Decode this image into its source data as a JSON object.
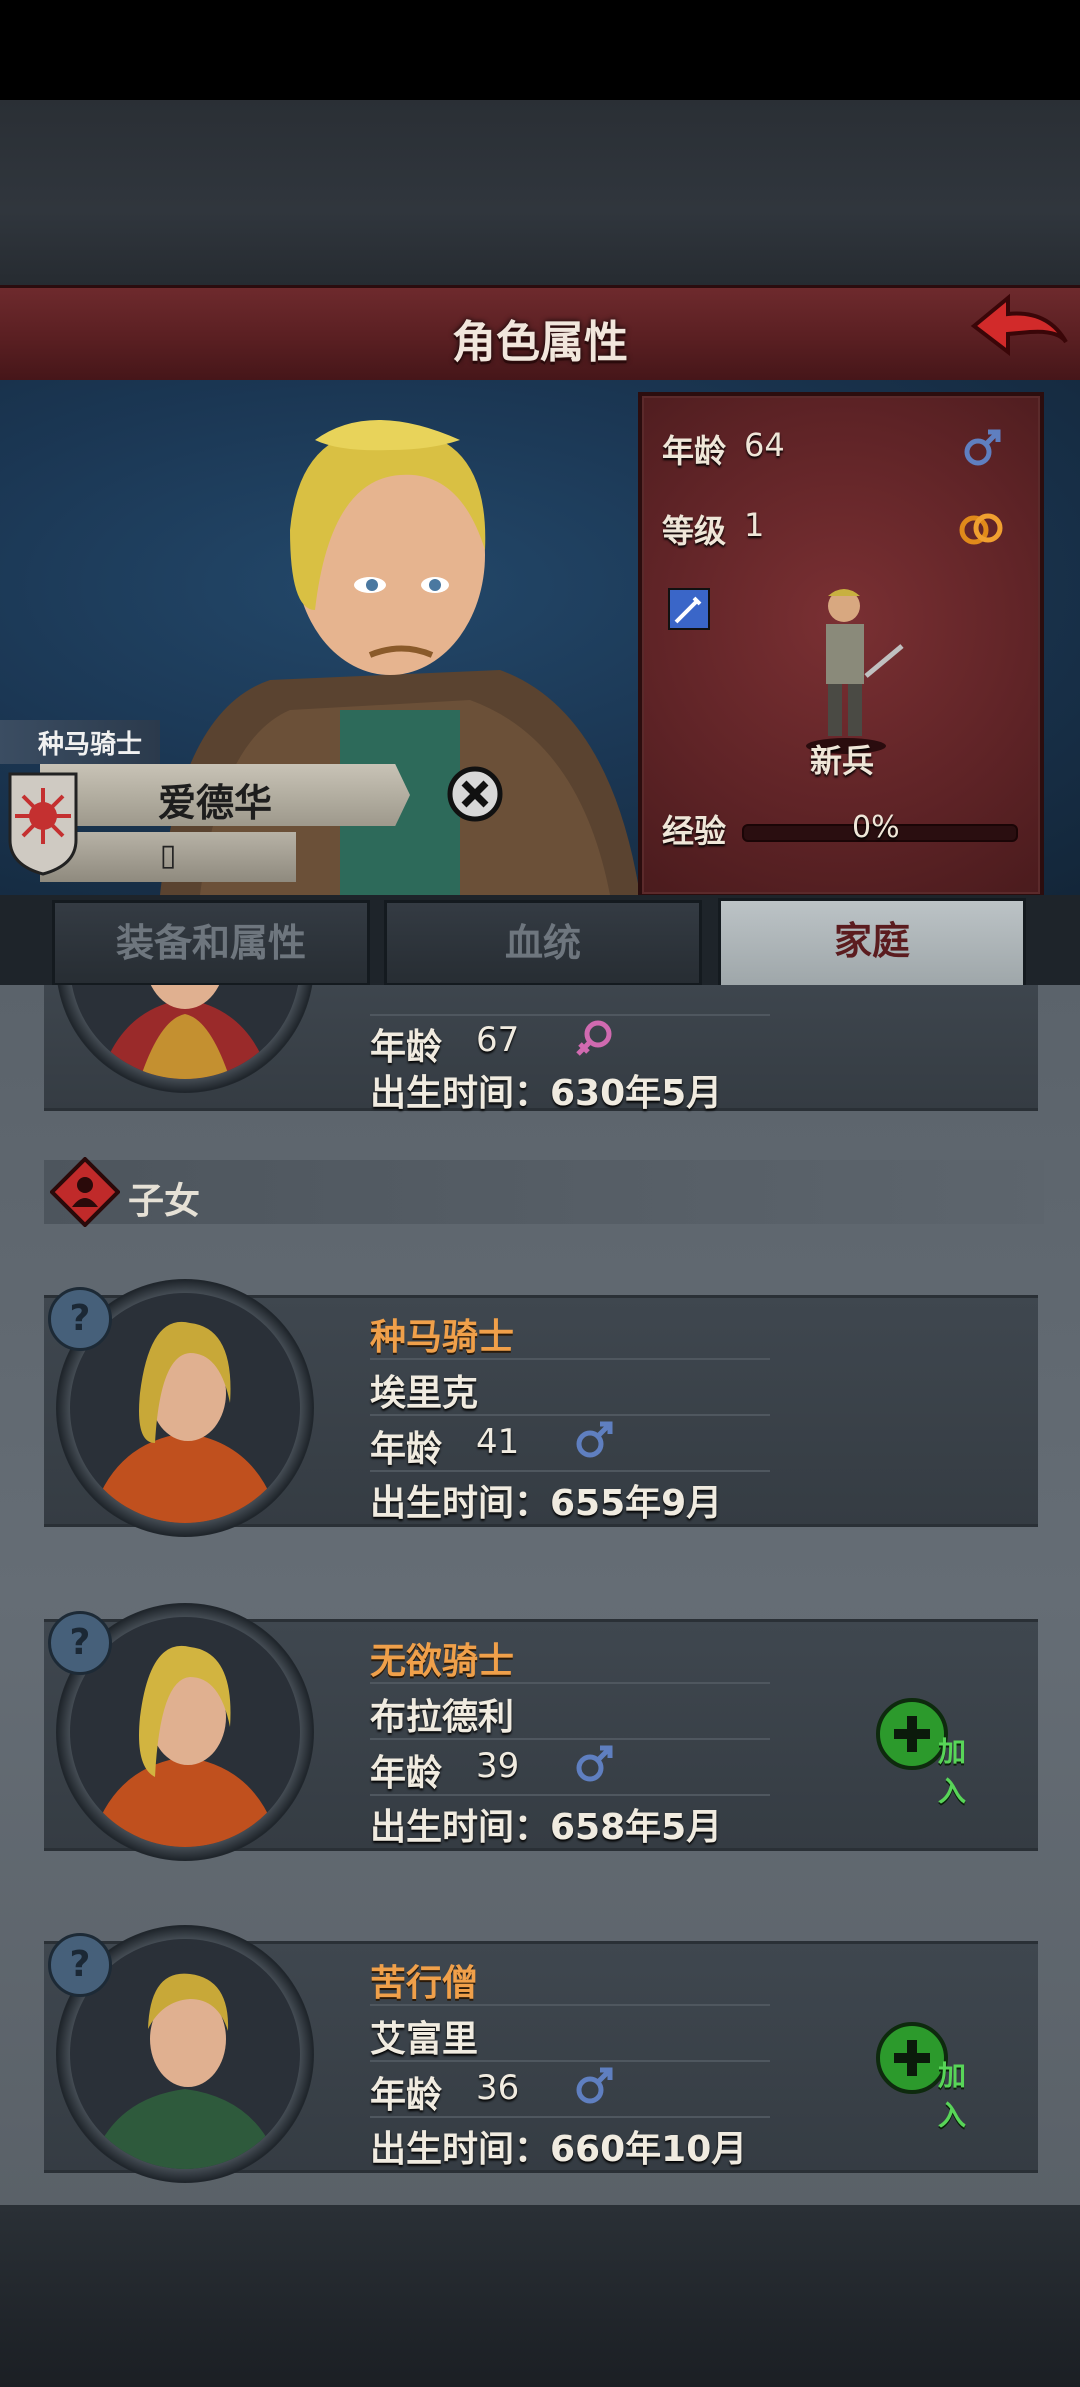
{
  "header": {
    "title": "角色属性"
  },
  "character": {
    "class": "种马骑士",
    "name": "爱德华",
    "subtitle": "▯"
  },
  "stats": {
    "age_label": "年龄",
    "age_value": "64",
    "level_label": "等级",
    "level_value": "1",
    "unit_name": "新兵",
    "exp_label": "经验",
    "exp_percent": "0%",
    "exp_fraction": 0
  },
  "tabs": [
    {
      "label": "装备和属性"
    },
    {
      "label": "血统"
    },
    {
      "label": "家庭",
      "active": true
    }
  ],
  "family": {
    "parent": {
      "age_label": "年龄",
      "age_value": "67",
      "gender": "female",
      "birth": "出生时间：630年5月"
    },
    "children_header": "子女",
    "children": [
      {
        "title": "种马骑士",
        "name": "埃里克",
        "age_label": "年龄",
        "age_value": "41",
        "gender": "male",
        "birth": "出生时间：655年9月",
        "join": ""
      },
      {
        "title": "无欲骑士",
        "name": "布拉德利",
        "age_label": "年龄",
        "age_value": "39",
        "gender": "male",
        "birth": "出生时间：658年5月",
        "join": "加入"
      },
      {
        "title": "苦行僧",
        "name": "艾富里",
        "age_label": "年龄",
        "age_value": "36",
        "gender": "male",
        "birth": "出生时间：660年10月",
        "join": "加入"
      }
    ]
  },
  "colors": {
    "title_bar": "#5a1f22",
    "stats_panel": "#6a2a2d",
    "title_orange": "#f0a04a",
    "join_green": "#2c9a2c",
    "male_icon": "#5f7fc0",
    "female_icon": "#d06ab0"
  },
  "icons": [
    "back-arrow-icon",
    "male-icon",
    "female-icon",
    "ring-icon",
    "sword-skill-icon",
    "close-icon",
    "heraldic-shield-icon",
    "question-icon",
    "plus-icon",
    "family-diamond-icon"
  ]
}
